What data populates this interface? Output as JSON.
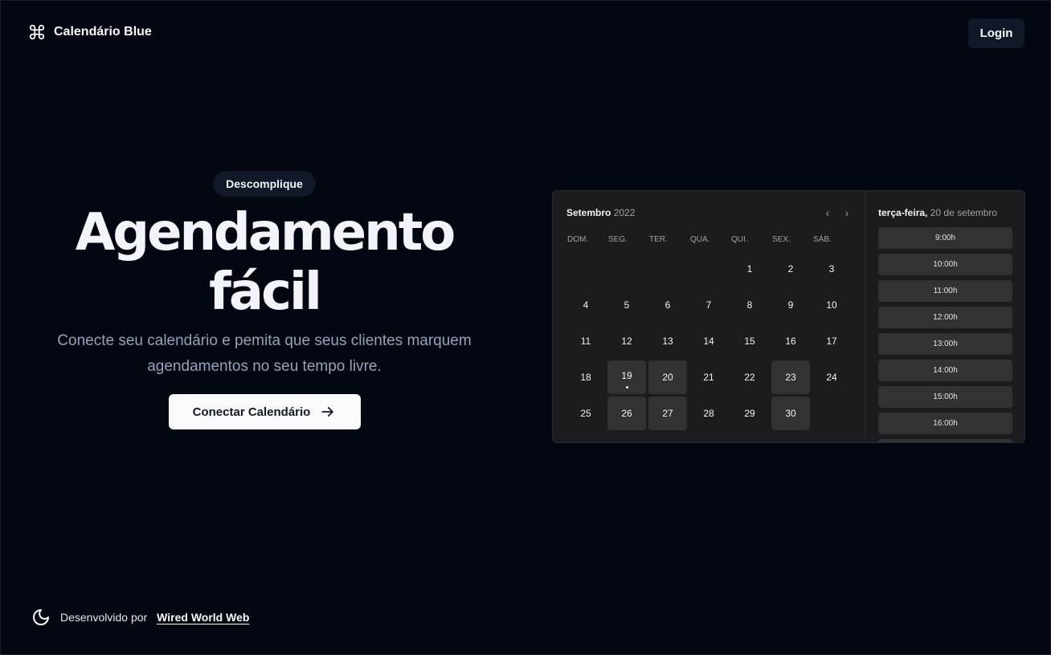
{
  "header": {
    "brand_icon": "command-icon",
    "brand_name": "Calendário Blue",
    "login_label": "Login"
  },
  "hero": {
    "badge": "Descomplique",
    "title_line1": "Agendamento",
    "title_line2": "fácil",
    "subtitle": "Conecte seu calendário e pemita que seus clientes marquem agendamentos no seu tempo livre.",
    "cta_label": "Conectar Calendário",
    "cta_icon": "arrow-right-icon"
  },
  "calendar": {
    "month": "Setembro",
    "year": "2022",
    "prev_icon": "chevron-left-icon",
    "next_icon": "chevron-right-icon",
    "weekdays": [
      "DOM.",
      "SEG.",
      "TER.",
      "QUA.",
      "QUI.",
      "SEX.",
      "SÁB."
    ],
    "days": [
      {
        "n": "",
        "avail": false
      },
      {
        "n": "",
        "avail": false
      },
      {
        "n": "",
        "avail": false
      },
      {
        "n": "",
        "avail": false
      },
      {
        "n": "1",
        "avail": false
      },
      {
        "n": "2",
        "avail": false
      },
      {
        "n": "3",
        "avail": false
      },
      {
        "n": "4",
        "avail": false
      },
      {
        "n": "5",
        "avail": false
      },
      {
        "n": "6",
        "avail": false
      },
      {
        "n": "7",
        "avail": false
      },
      {
        "n": "8",
        "avail": false
      },
      {
        "n": "9",
        "avail": false
      },
      {
        "n": "10",
        "avail": false
      },
      {
        "n": "11",
        "avail": false
      },
      {
        "n": "12",
        "avail": false
      },
      {
        "n": "13",
        "avail": false
      },
      {
        "n": "14",
        "avail": false
      },
      {
        "n": "15",
        "avail": false
      },
      {
        "n": "16",
        "avail": false
      },
      {
        "n": "17",
        "avail": false
      },
      {
        "n": "18",
        "avail": false
      },
      {
        "n": "19",
        "avail": true,
        "today": true
      },
      {
        "n": "20",
        "avail": true
      },
      {
        "n": "21",
        "avail": false
      },
      {
        "n": "22",
        "avail": false
      },
      {
        "n": "23",
        "avail": true
      },
      {
        "n": "24",
        "avail": false
      },
      {
        "n": "25",
        "avail": false
      },
      {
        "n": "26",
        "avail": true
      },
      {
        "n": "27",
        "avail": true
      },
      {
        "n": "28",
        "avail": false
      },
      {
        "n": "29",
        "avail": false
      },
      {
        "n": "30",
        "avail": true
      }
    ]
  },
  "timepicker": {
    "weekday": "terça-feira,",
    "date": "20 de setembro",
    "slots": [
      "9:00h",
      "10:00h",
      "11:00h",
      "12:00h",
      "13:00h",
      "14:00h",
      "15:00h",
      "16:00h"
    ]
  },
  "footer": {
    "theme_icon": "moon-icon",
    "credit_prefix": "Desenvolvido por",
    "credit_link": "Wired World Web"
  }
}
